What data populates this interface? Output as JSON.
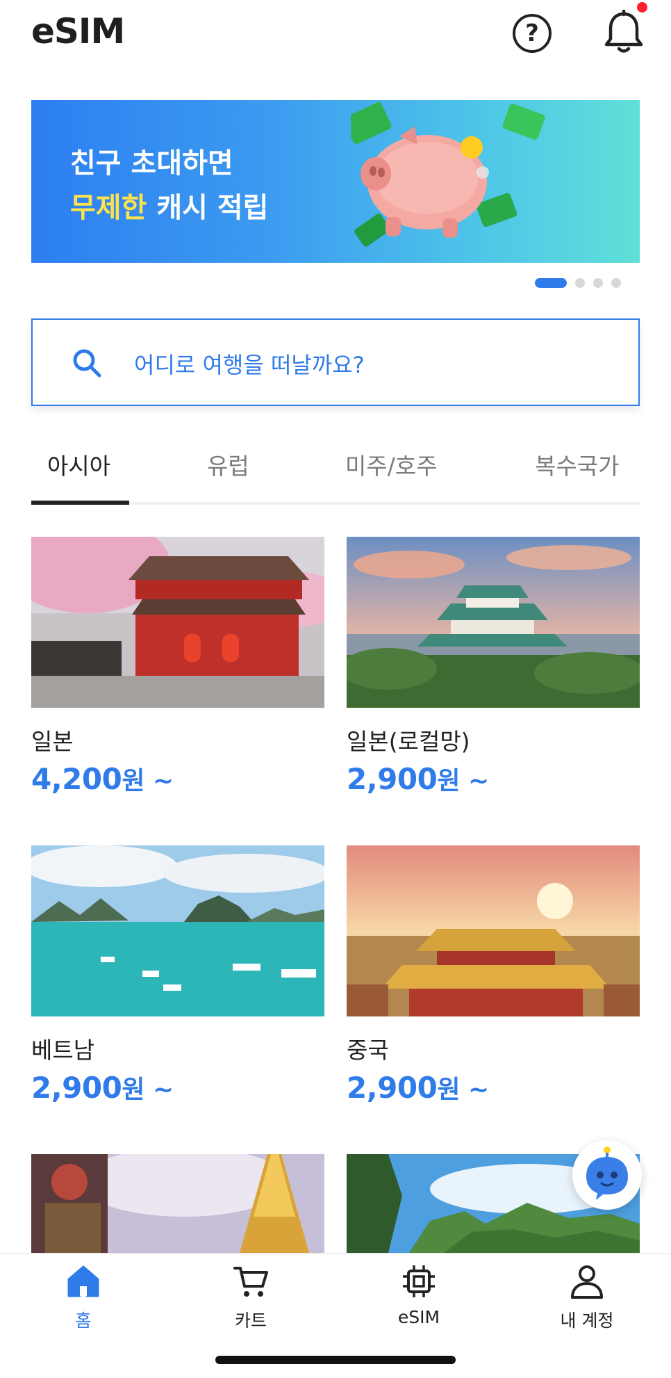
{
  "header": {
    "title": "eSIM",
    "help_icon": "question-circle-icon",
    "bell_icon": "bell-icon",
    "notification_dot_color": "#ff1e2d"
  },
  "banner": {
    "line1": "친구 초대하면",
    "line2_highlight": "무제한",
    "line2_rest": " 캐시 적립",
    "highlight_color": "#ffe34a",
    "art_icon": "piggy-bank-icon",
    "carousel_count": 4,
    "carousel_active": 1
  },
  "search": {
    "placeholder": "어디로 여행을 떠날까요?"
  },
  "tabs": [
    {
      "label": "아시아",
      "active": true
    },
    {
      "label": "유럽",
      "active": false
    },
    {
      "label": "미주/호주",
      "active": false
    },
    {
      "label": "복수국가",
      "active": false
    }
  ],
  "products": [
    {
      "name": "일본",
      "price": "4,200",
      "unit": "원 ~"
    },
    {
      "name": "일본(로컬망)",
      "price": "2,900",
      "unit": "원 ~"
    },
    {
      "name": "베트남",
      "price": "2,900",
      "unit": "원 ~"
    },
    {
      "name": "중국",
      "price": "2,900",
      "unit": "원 ~"
    },
    {
      "name": "",
      "price": "",
      "unit": ""
    },
    {
      "name": "",
      "price": "",
      "unit": ""
    }
  ],
  "nav": {
    "home": "홈",
    "cart": "카트",
    "esim": "eSIM",
    "account": "내 계정"
  },
  "colors": {
    "accent": "#2f7bea",
    "text": "#222222"
  }
}
